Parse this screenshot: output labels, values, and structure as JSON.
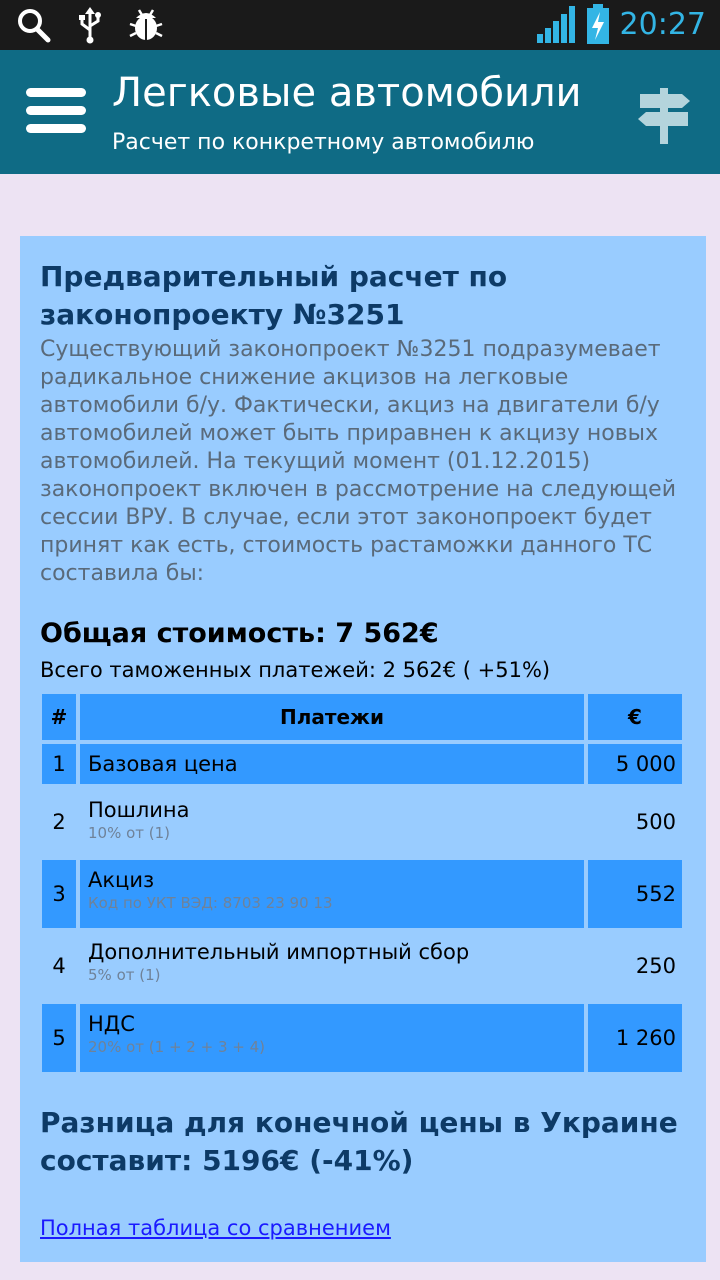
{
  "status_bar": {
    "time": "20:27",
    "icons_left": [
      "search-icon",
      "usb-icon",
      "bug-icon"
    ],
    "icons_right": [
      "signal-icon",
      "battery-charging-icon"
    ]
  },
  "action_bar": {
    "title": "Легковые автомобили",
    "subtitle": "Расчет по конкретному автомобилю",
    "menu_icon": "hamburger-menu-icon",
    "right_icon": "signpost-icon"
  },
  "card": {
    "title": "Предварительный расчет по законопроекту №3251",
    "description": "Существующий законопроект №3251 подразумевает радикальное снижение акцизов на легковые автомобили б/у. Фактически, акциз на двигатели б/у автомобилей может быть приравнен к акцизу новых автомобилей. На текущий момент (01.12.2015) законопроект включен в рассмотрение на следующей сессии ВРУ. В случае, если этот законопроект будет принят как есть, стоимость растаможки данного ТС составила бы:",
    "total_cost": "Общая стоимость: 7 562€",
    "total_payments": "Всего таможенных платежей: 2 562€ ( +51%)",
    "table": {
      "headers": [
        "#",
        "Платежи",
        "€"
      ],
      "rows": [
        {
          "num": "1",
          "name": "Базовая цена",
          "sub": "",
          "value": "5 000"
        },
        {
          "num": "2",
          "name": "Пошлина",
          "sub": "10% от (1)",
          "value": "500"
        },
        {
          "num": "3",
          "name": "Акциз",
          "sub": "Код по УКТ ВЭД: 8703 23 90 13",
          "value": "552"
        },
        {
          "num": "4",
          "name": "Дополнительный импортный сбор",
          "sub": "5% от (1)",
          "value": "250"
        },
        {
          "num": "5",
          "name": "НДС",
          "sub": "20% от (1 + 2 + 3 + 4)",
          "value": "1 260"
        }
      ]
    },
    "difference": "Разница для конечной цены в Украине составит: 5196€ (-41%)",
    "full_table_link": "Полная таблица со сравнением"
  },
  "colors": {
    "action_bar": "#0f6b85",
    "card_background": "#99ccff",
    "table_accent": "#3399ff",
    "heading_text": "#0d3a66",
    "link": "#1a1aff"
  }
}
